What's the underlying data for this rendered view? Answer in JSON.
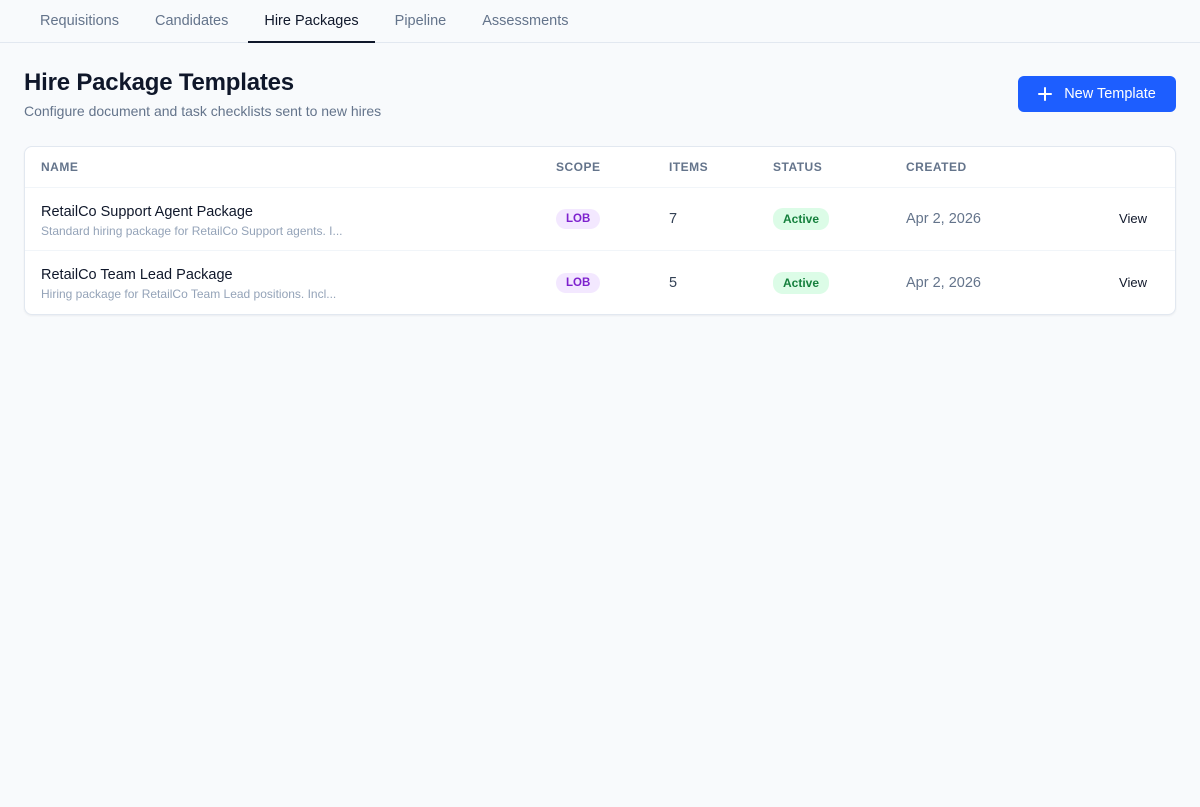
{
  "nav": {
    "tabs": [
      {
        "label": "Requisitions"
      },
      {
        "label": "Candidates"
      },
      {
        "label": "Hire Packages"
      },
      {
        "label": "Pipeline"
      },
      {
        "label": "Assessments"
      }
    ],
    "active_tab": "Hire Packages"
  },
  "header": {
    "title": "Hire Package Templates",
    "subtitle": "Configure document and task checklists sent to new hires",
    "new_button_label": "New Template",
    "new_button_icon": "plus-icon",
    "accent_color": "#1d5eff"
  },
  "table": {
    "columns": [
      "NAME",
      "SCOPE",
      "ITEMS",
      "STATUS",
      "CREATED"
    ],
    "rows": [
      {
        "name": "RetailCo Support Agent Package",
        "description": "Standard hiring package for RetailCo Support agents. I...",
        "scope": "LOB",
        "items": "7",
        "status": "Active",
        "created": "Apr 2, 2026",
        "action": "View"
      },
      {
        "name": "RetailCo Team Lead Package",
        "description": "Hiring package for RetailCo Team Lead positions. Incl...",
        "scope": "LOB",
        "items": "5",
        "status": "Active",
        "created": "Apr 2, 2026",
        "action": "View"
      }
    ]
  }
}
